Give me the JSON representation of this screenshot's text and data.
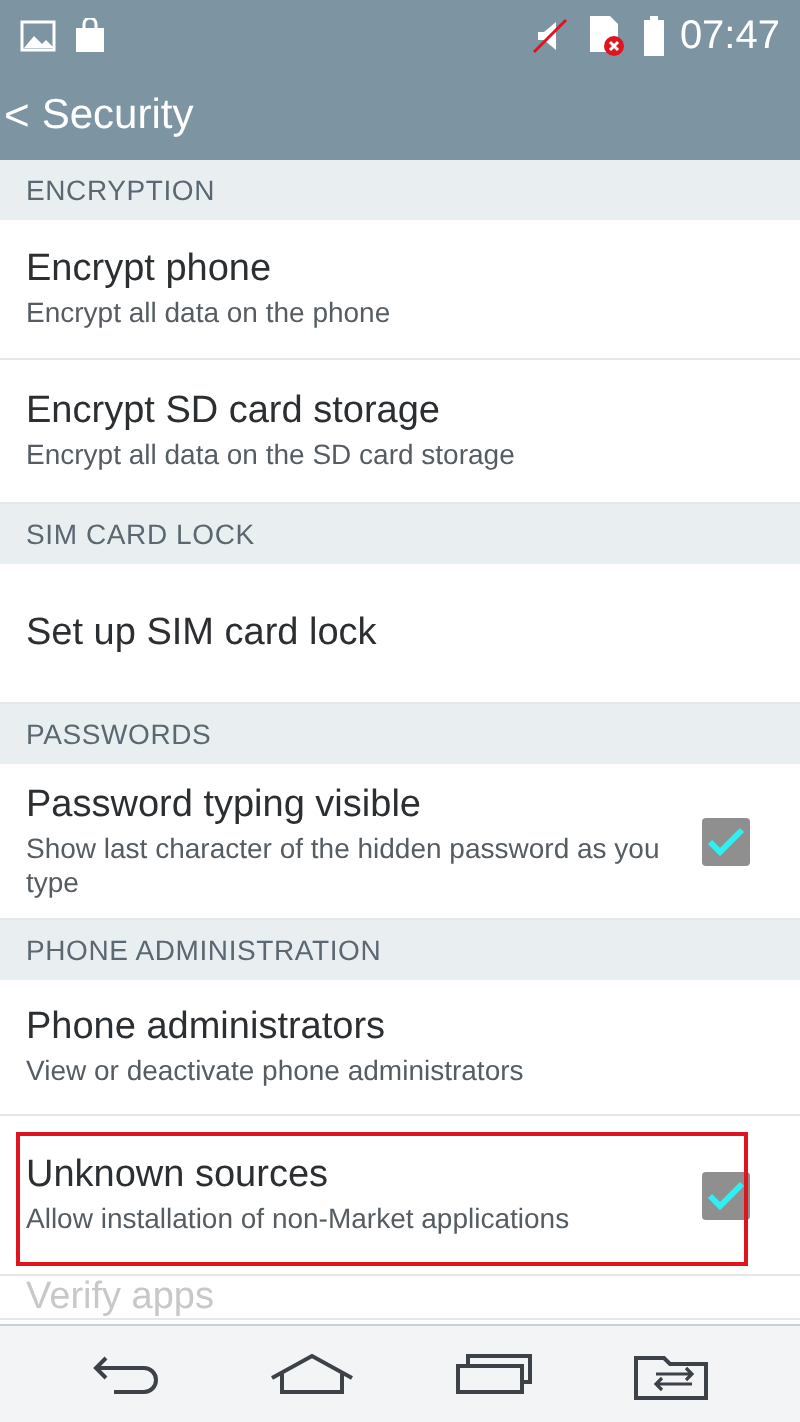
{
  "status_bar": {
    "time": "07:47"
  },
  "header": {
    "back": "<",
    "title": "Security"
  },
  "sections": [
    {
      "title": "ENCRYPTION",
      "items": [
        {
          "kind": "plain",
          "title": "Encrypt phone",
          "summary": "Encrypt all data on the phone",
          "highlighted": false
        },
        {
          "kind": "plain",
          "title": "Encrypt SD card storage",
          "summary": "Encrypt all data on the SD card storage",
          "highlighted": false
        }
      ]
    },
    {
      "title": "SIM CARD LOCK",
      "items": [
        {
          "kind": "plain",
          "title": "Set up SIM card lock",
          "highlighted": false
        }
      ]
    },
    {
      "title": "PASSWORDS",
      "items": [
        {
          "kind": "checkbox",
          "title": "Password typing visible",
          "summary": "Show last character of the hidden password as you type",
          "checked": true,
          "highlighted": false
        }
      ]
    },
    {
      "title": "PHONE ADMINISTRATION",
      "items": [
        {
          "kind": "plain",
          "title": "Phone administrators",
          "summary": "View or deactivate phone administrators",
          "highlighted": false
        },
        {
          "kind": "checkbox",
          "title": "Unknown sources",
          "summary": "Allow installation of non-Market applications",
          "checked": true,
          "highlighted": true
        },
        {
          "kind": "faded",
          "title": "Verify apps",
          "highlighted": false
        }
      ]
    }
  ]
}
